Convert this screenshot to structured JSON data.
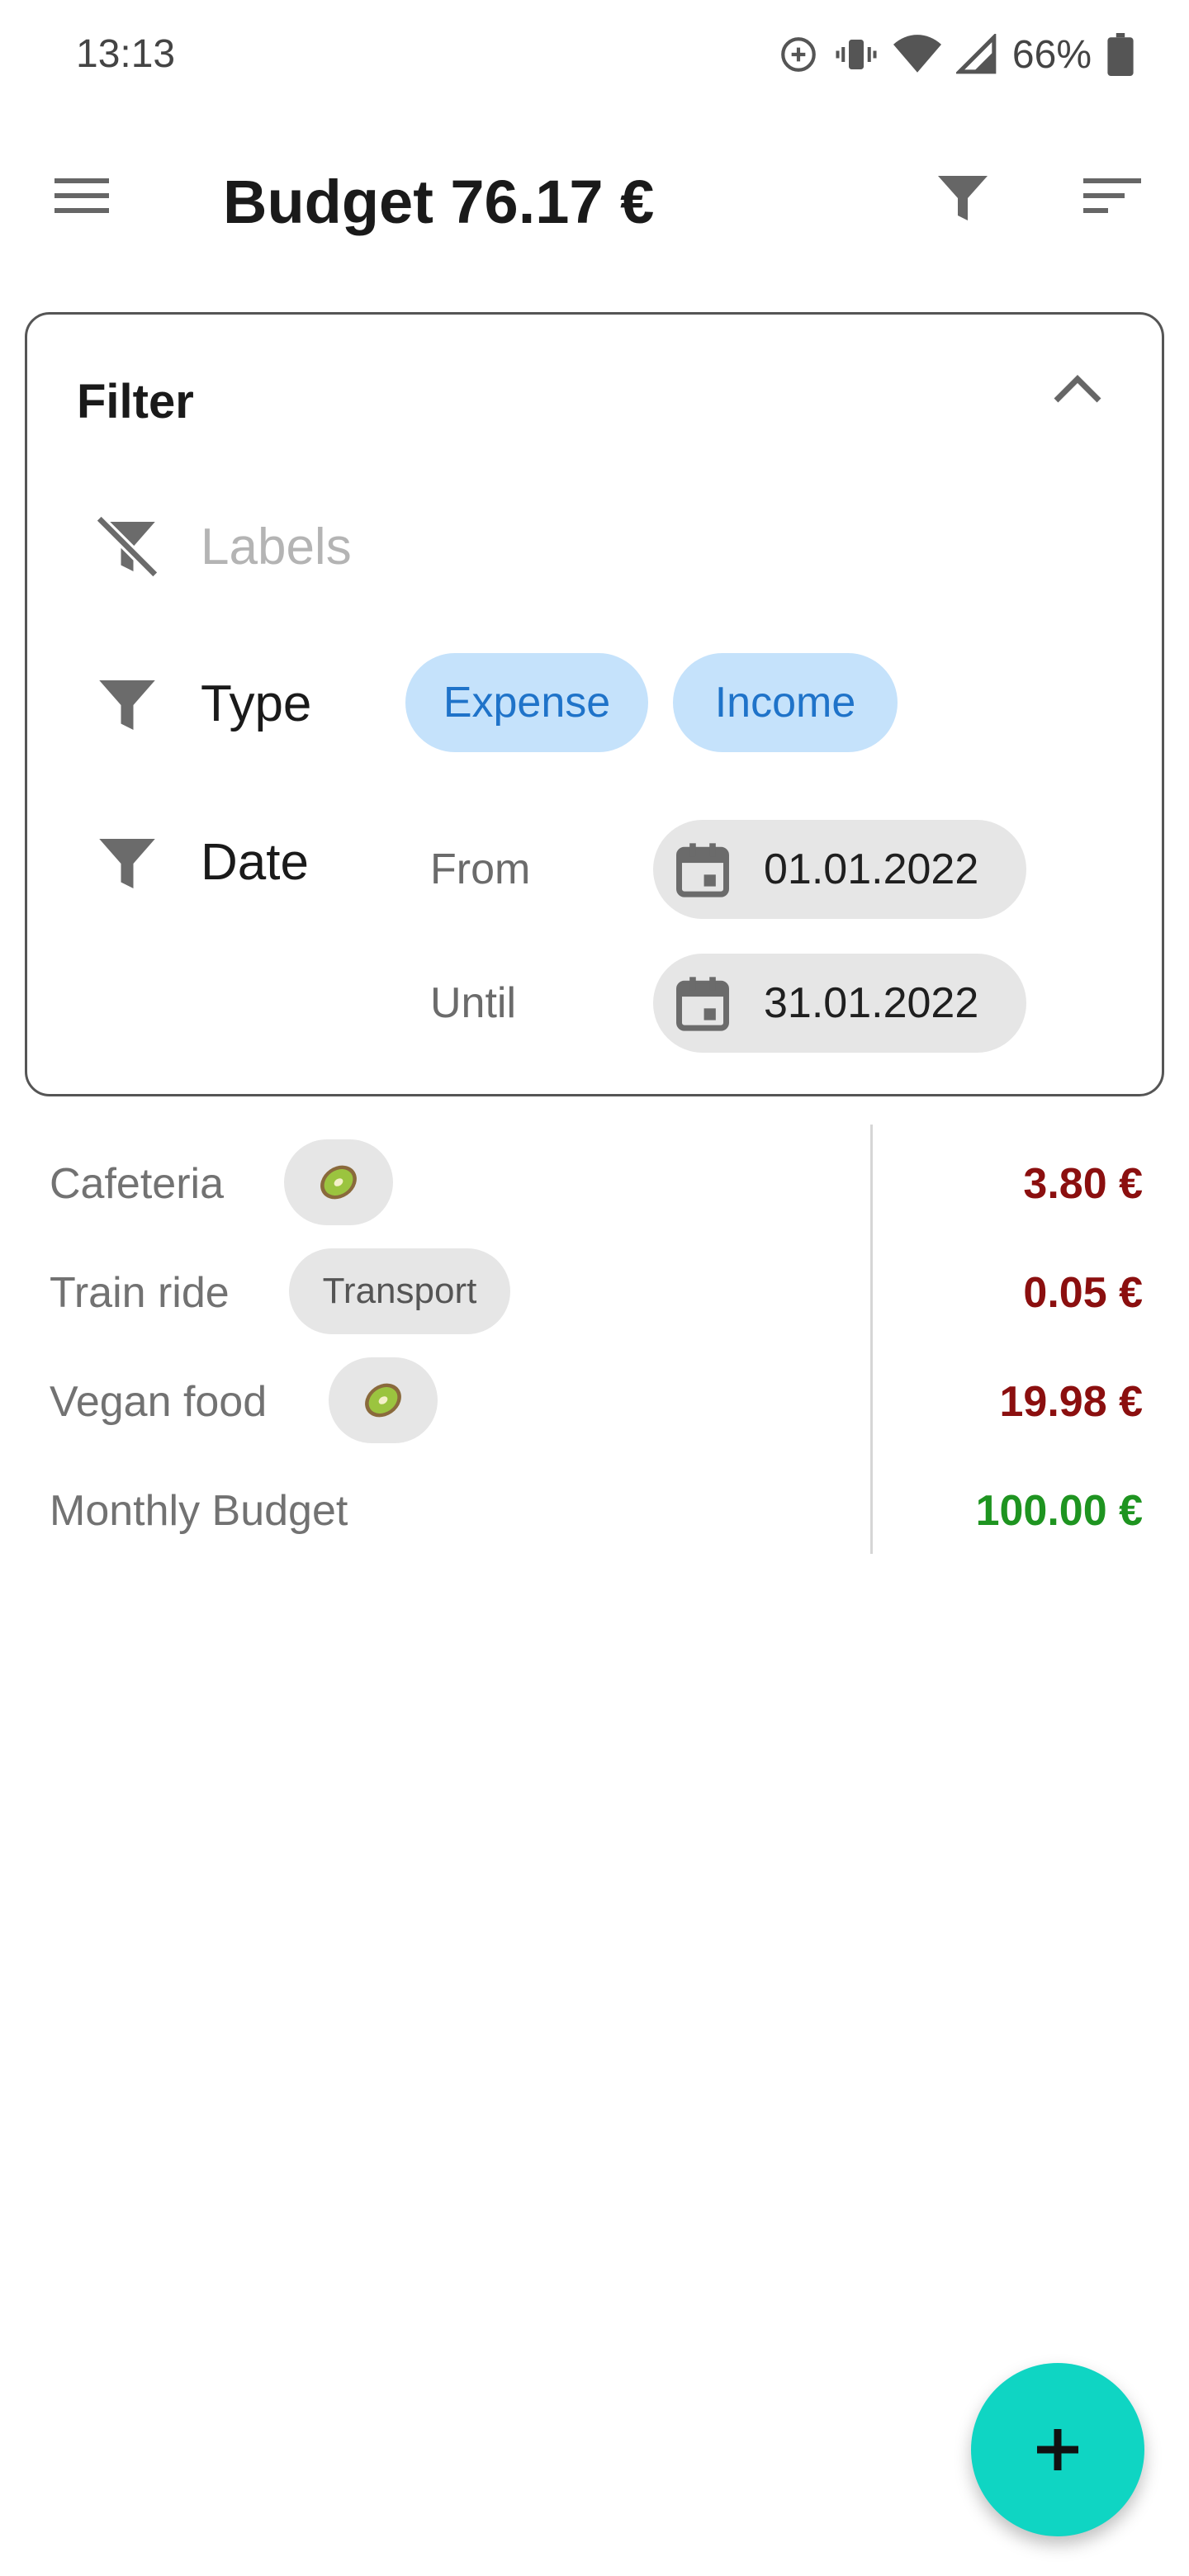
{
  "status_bar": {
    "time": "13:13",
    "battery": "66%"
  },
  "app_bar": {
    "title": "Budget 76.17 €"
  },
  "filter": {
    "title": "Filter",
    "labels_placeholder": "Labels",
    "type_label": "Type",
    "type_options": [
      "Expense",
      "Income"
    ],
    "date_label": "Date",
    "from_label": "From",
    "from_value": "01.01.2022",
    "until_label": "Until",
    "until_value": "31.01.2022"
  },
  "transactions": [
    {
      "name": "Cafeteria",
      "tag": "kiwi",
      "amount": "3.80 €",
      "kind": "expense"
    },
    {
      "name": "Train ride",
      "tag": "Transport",
      "amount": "0.05 €",
      "kind": "expense"
    },
    {
      "name": "Vegan food",
      "tag": "kiwi",
      "amount": "19.98 €",
      "kind": "expense"
    },
    {
      "name": "Monthly Budget",
      "tag": "",
      "amount": "100.00 €",
      "kind": "income"
    }
  ],
  "colors": {
    "expense": "#8b0f0f",
    "income": "#1e9420",
    "fab": "#0fd5c3",
    "chip_selected": "#c5e2fb"
  },
  "icons": [
    "menu-icon",
    "filter-icon",
    "sort-icon",
    "chevron-up-icon",
    "filter-off-icon",
    "calendar-icon",
    "kiwi-icon",
    "plus-icon"
  ]
}
